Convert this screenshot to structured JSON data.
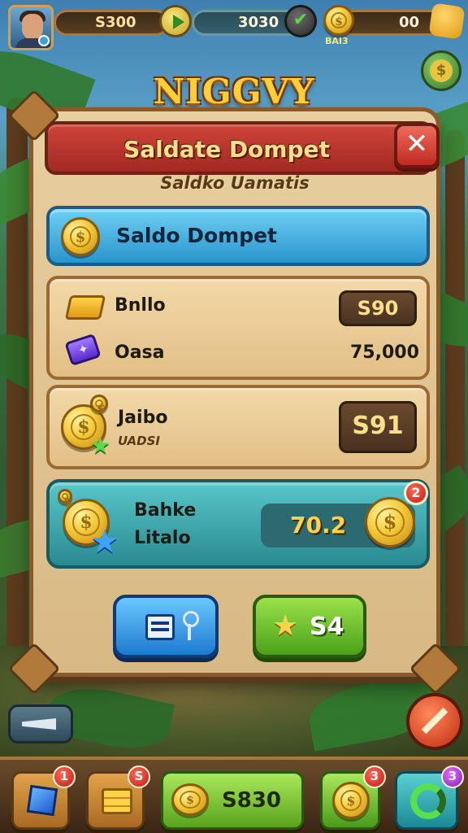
{
  "topbar": {
    "resource_1": "S300",
    "resource_2": "3030",
    "resource_3": "00",
    "coin_caption": "BAI3"
  },
  "title": "NIGGVY",
  "panel": {
    "title": "Saldate Dompet",
    "subtitle": "Saldko Uamatis",
    "close_icon": "✕",
    "wallet_label": "Saldo Dompet",
    "rows": [
      {
        "label": "Bnllo",
        "value": "S90",
        "icon": "gold-bar-icon"
      },
      {
        "label": "Oasa",
        "value": "75,000",
        "icon": "purple-gem-icon"
      }
    ],
    "jaibo": {
      "label": "Jaibo",
      "sublabel": "UADSI",
      "value": "S91"
    },
    "teal": {
      "line1": "Bahke",
      "line2": "Litalo",
      "value": "70.2",
      "badge": "2"
    },
    "green_button": "S4"
  },
  "bottombar": {
    "slot_1_badge": "1",
    "slot_2_badge": "S",
    "slot_3_label": "S830",
    "slot_4_badge": "3",
    "slot_5_badge": "3"
  },
  "colors": {
    "panel_header": "#c0362c",
    "wallet_bar": "#3aa8dc",
    "teal_card": "#3aa4a8",
    "green_button": "#6cc02a",
    "blue_button": "#3a9ae8"
  }
}
